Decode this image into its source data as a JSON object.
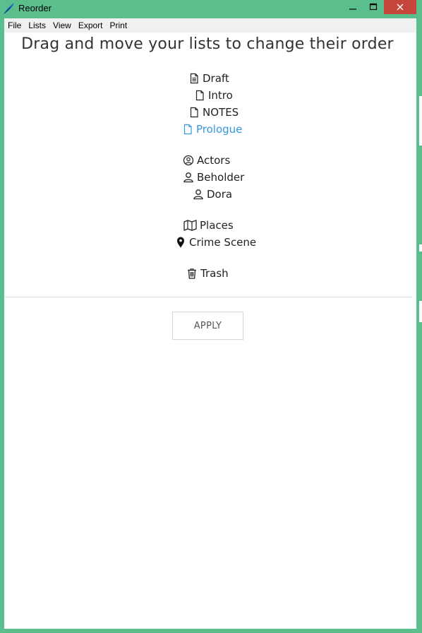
{
  "window": {
    "title": "Reorder",
    "minimize_glyph": "—",
    "maximize_glyph": "☐",
    "close_glyph": "✕"
  },
  "menu": [
    "File",
    "Lists",
    "View",
    "Export",
    "Print"
  ],
  "heading": "Drag and move your lists to change their order",
  "lists": [
    {
      "label": "Draft",
      "icon": "file-text-icon"
    },
    {
      "label": "Intro",
      "icon": "file-icon"
    },
    {
      "label": "NOTES",
      "icon": "file-icon"
    },
    {
      "label": "Prologue",
      "icon": "file-icon",
      "active": true
    },
    {
      "label": "Actors",
      "icon": "user-circle-icon"
    },
    {
      "label": "Beholder",
      "icon": "user-icon"
    },
    {
      "label": "Dora",
      "icon": "user-icon"
    },
    {
      "label": "Places",
      "icon": "map-icon"
    },
    {
      "label": "Crime Scene",
      "icon": "map-pin-icon"
    },
    {
      "label": "Trash",
      "icon": "trash-icon"
    }
  ],
  "apply_label": "APPLY",
  "colors": {
    "window_frame": "#5bbf8d",
    "close_button": "#c7463b",
    "active_item": "#3399dd"
  }
}
